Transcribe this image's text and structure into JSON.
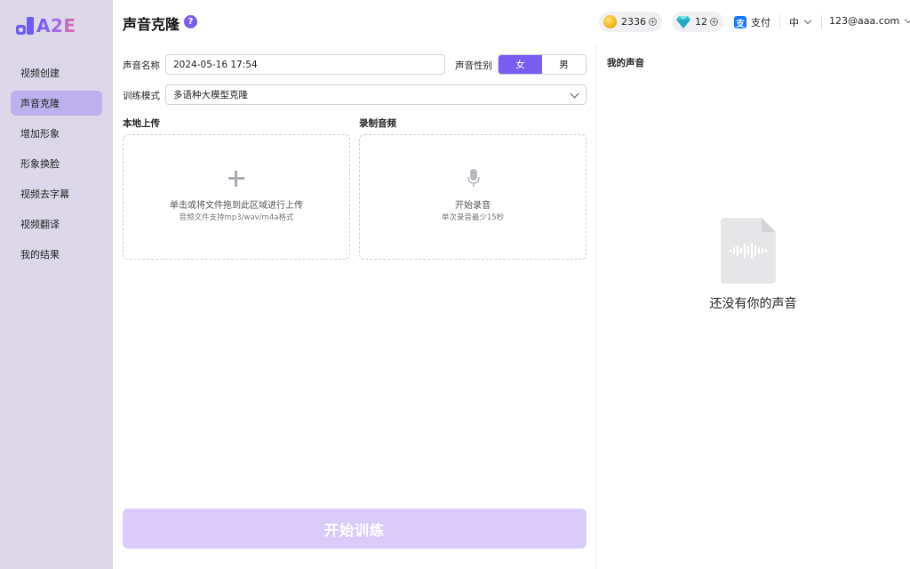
{
  "brand": {
    "logo_text": "A2E"
  },
  "sidebar": {
    "items": [
      {
        "label": "视频创建",
        "active": false
      },
      {
        "label": "声音克隆",
        "active": true
      },
      {
        "label": "增加形象",
        "active": false
      },
      {
        "label": "形象换脸",
        "active": false
      },
      {
        "label": "视频去字幕",
        "active": false
      },
      {
        "label": "视频翻译",
        "active": false
      },
      {
        "label": "我的结果",
        "active": false
      }
    ]
  },
  "header": {
    "title": "声音克隆",
    "help": "?",
    "coins": "2336",
    "gems": "12",
    "pay_label": "支付",
    "language": "中",
    "user_email": "123@aaa.com"
  },
  "form": {
    "name_label": "声音名称",
    "name_value": "2024-05-16 17:54",
    "gender_label": "声音性别",
    "gender_female": "女",
    "gender_male": "男",
    "gender_selected": "女",
    "mode_label": "训练模式",
    "mode_value": "多语种大模型克隆",
    "upload_title": "本地上传",
    "upload_main": "单击或将文件拖到此区域进行上传",
    "upload_hint": "音频文件支持mp3/wav/m4a格式",
    "record_title": "录制音频",
    "record_main": "开始录音",
    "record_hint": "单次录音最少15秒",
    "train_button": "开始训练"
  },
  "right_panel": {
    "title": "我的声音",
    "empty_text": "还没有你的声音"
  },
  "colors": {
    "accent": "#7a5cf0",
    "sidebar_bg": "#dcd8ea",
    "active_item": "#bcb1ee",
    "train_button_disabled": "#d9ccfb"
  }
}
